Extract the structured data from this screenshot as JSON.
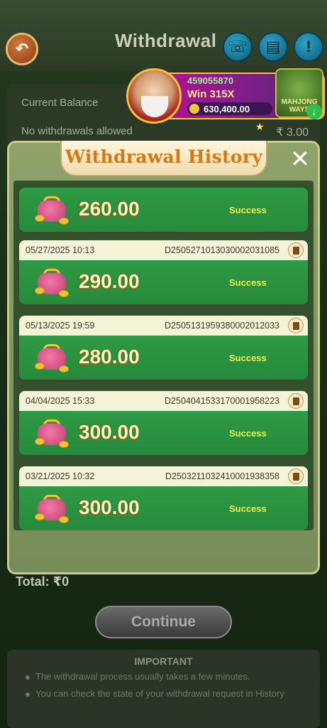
{
  "header": {
    "title": "Withdrawal"
  },
  "balance": {
    "current_balance_label": "Current Balance",
    "no_withdrawals_label": "No withdrawals allowed",
    "no_withdrawals_value": "₹ 3.00"
  },
  "promo": {
    "player_id": "459055870",
    "win_text": "Win 315X",
    "amount": "630,400.00",
    "game_name": "MAHJONG WAYS"
  },
  "modal": {
    "title": "Withdrawal History",
    "records": [
      {
        "date": "",
        "id": "",
        "amount": "260.00",
        "status": "Success"
      },
      {
        "date": "05/27/2025 10:13",
        "id": "D2505271013030002031085",
        "amount": "290.00",
        "status": "Success"
      },
      {
        "date": "05/13/2025 19:59",
        "id": "D2505131959380002012033",
        "amount": "280.00",
        "status": "Success"
      },
      {
        "date": "04/04/2025 15:33",
        "id": "D2504041533170001958223",
        "amount": "300.00",
        "status": "Success"
      },
      {
        "date": "03/21/2025 10:32",
        "id": "D2503211032410001938358",
        "amount": "300.00",
        "status": "Success"
      }
    ]
  },
  "footer": {
    "total_label": "Total: ₹0",
    "continue_label": "Continue",
    "important_title": "IMPORTANT",
    "notes": [
      "The withdrawal process usually takes a few minutes.",
      "You can check the state of your withdrawal request in History"
    ]
  },
  "colors": {
    "status_success": "#e8f24a",
    "modal_title": "#d67818",
    "record_body": "#2f9a45"
  }
}
